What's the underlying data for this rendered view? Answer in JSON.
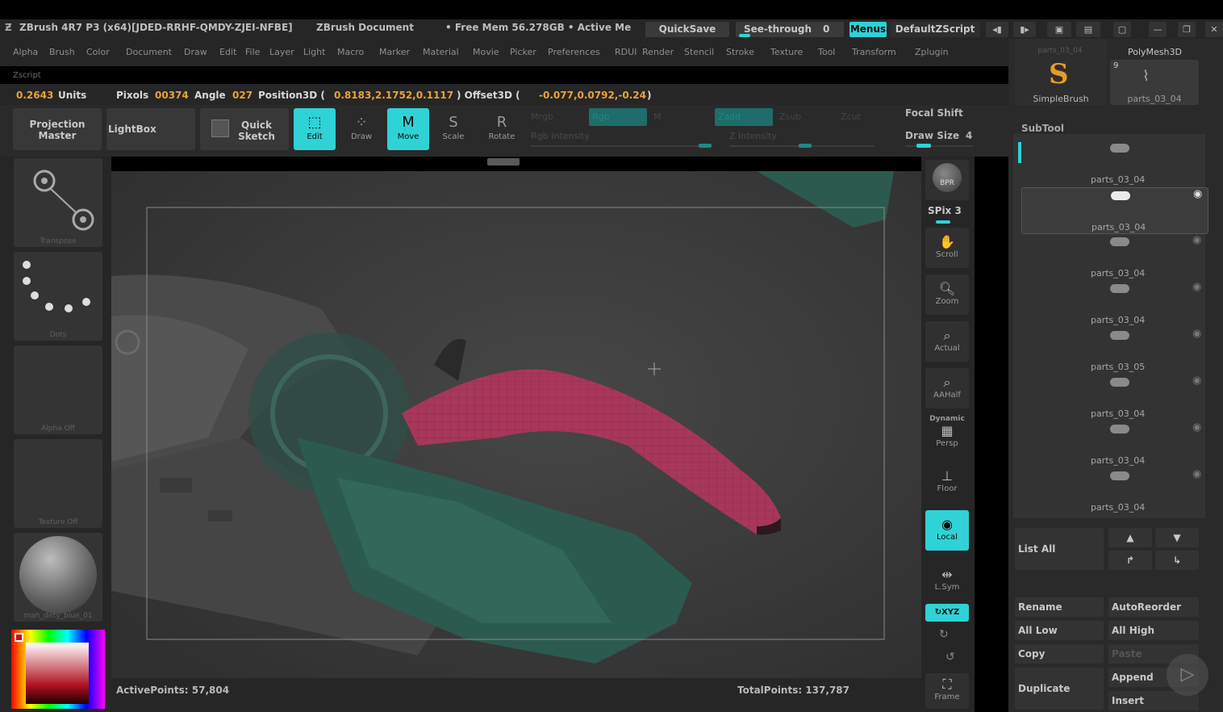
{
  "title_bar": {
    "app_title": "ZBrush 4R7 P3 (x64)[JDED-RRHF-QMDY-ZJEI-NFBE]",
    "document": "ZBrush Document",
    "memory": "• Free Mem 56.278GB • Active Me",
    "quicksave": "QuickSave",
    "see_through_label": "See-through",
    "see_through_value": "0",
    "menus": "Menus",
    "default_zscript": "DefaultZScript"
  },
  "menu_items": [
    "Alpha",
    "Brush",
    "Color",
    "Document",
    "Draw",
    "Edit",
    "File",
    "Layer",
    "Light",
    "Macro",
    "Marker",
    "Material",
    "Movie",
    "Picker",
    "Preferences",
    "RDUI",
    "Render",
    "Stencil",
    "Stroke",
    "Texture",
    "Tool",
    "Transform",
    "Zplugin"
  ],
  "zscript_label": "Zscript",
  "info": {
    "units_value": "0.2643",
    "units_label": "Units",
    "pixols_label": "Pixols",
    "pixols_value": "00374",
    "angle_label": "Angle",
    "angle_value": "027",
    "pos_label": "Position3D (",
    "pos_value": "0.8183,2.1752,0.1117",
    "offset_label": ") Offset3D (",
    "offset_value": "-0.077,0.0792,-0.24",
    "close_paren": ")"
  },
  "toolbar": {
    "projection_master": "Projection Master",
    "lightbox": "LightBox",
    "quick_sketch": "Quick Sketch",
    "edit": "Edit",
    "draw": "Draw",
    "move": "Move",
    "scale": "Scale",
    "rotate": "Rotate",
    "mrgb": "Mrgb",
    "rgb": "Rgb",
    "m": "M",
    "zadd": "Zadd",
    "zsub": "Zsub",
    "zcut": "Zcut",
    "rgb_intensity": "Rgb Intensity",
    "z_intensity": "Z Intensity",
    "focal_shift": "Focal Shift",
    "draw_size_label": "Draw Size",
    "draw_size_value": "4"
  },
  "left_panel": {
    "transpose": "Transpose",
    "dots": "Dots",
    "alpha_off": "Alpha Off",
    "texture_off": "Texture Off",
    "material": "mah_dirty_blue_01"
  },
  "right_strip": {
    "bpr": "BPR",
    "spix_label": "SPix",
    "spix_value": "3",
    "scroll": "Scroll",
    "zoom": "Zoom",
    "actual": "Actual",
    "aahalf": "AAHalf",
    "dynamic": "Dynamic",
    "persp": "Persp",
    "floor": "Floor",
    "local": "Local",
    "lsym": "L.Sym",
    "xyz": "XYZ",
    "frame": "Frame"
  },
  "bottom": {
    "active_points": "ActivePoints: 57,804",
    "total_points": "TotalPoints: 137,787"
  },
  "subtool": {
    "header_tool": "parts_03_04",
    "polymesh": "PolyMesh3D",
    "simplebrush": "SimpleBrush",
    "current": "parts_03_04",
    "count": "9",
    "title": "SubTool",
    "items": [
      "parts_03_04",
      "parts_03_04",
      "parts_03_04",
      "parts_03_04",
      "parts_03_05",
      "parts_03_04",
      "parts_03_04",
      "parts_03_04"
    ],
    "list_all": "List All",
    "rename": "Rename",
    "auto_reorder": "AutoReorder",
    "all_low": "All Low",
    "all_high": "All High",
    "copy": "Copy",
    "paste": "Paste",
    "duplicate": "Duplicate",
    "append": "Append",
    "insert": "Insert"
  },
  "colors": {
    "accent": "#2fd2d6",
    "orange": "#e8a33a",
    "mesh_pink": "#a8375a",
    "mesh_teal": "#2c5a4e"
  }
}
